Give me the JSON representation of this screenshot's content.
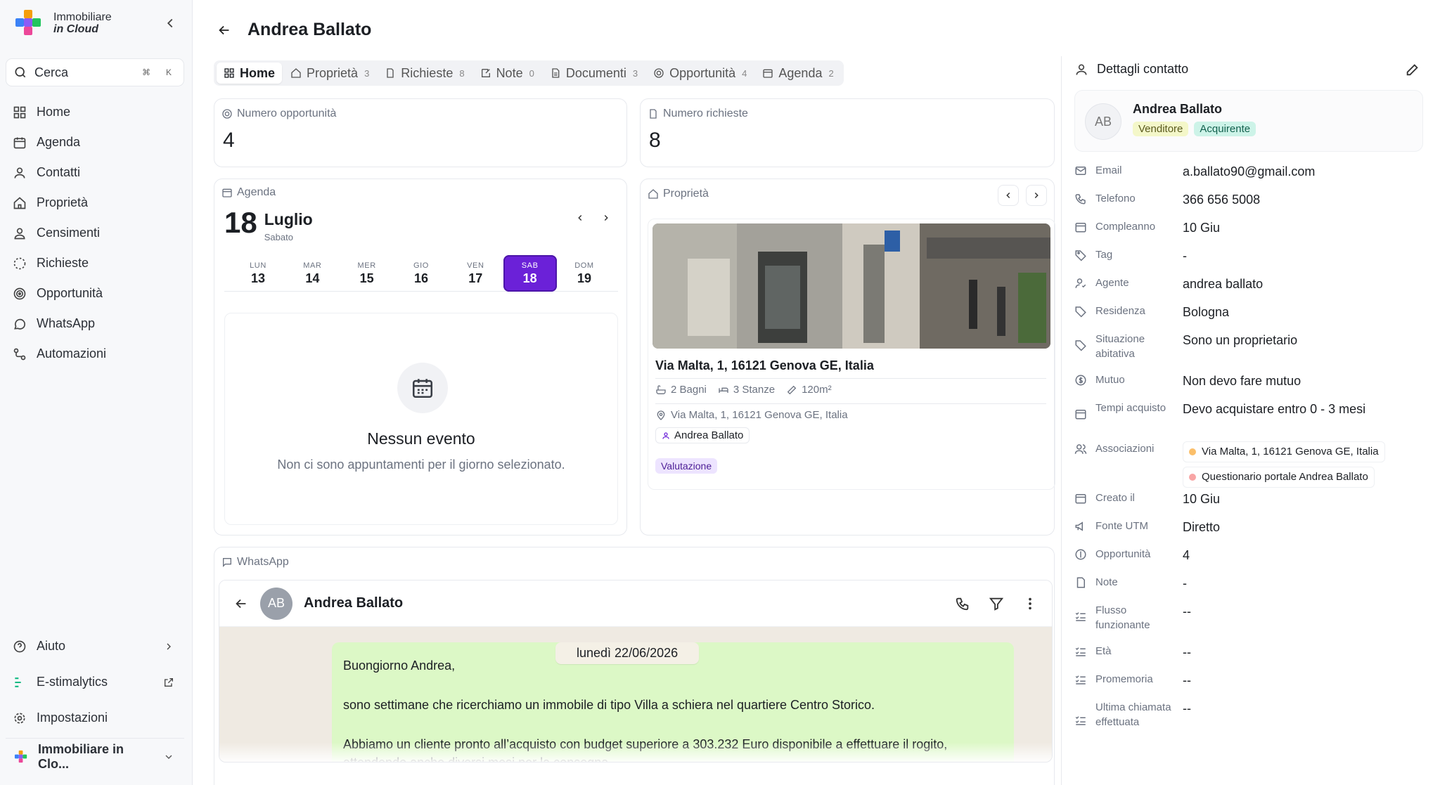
{
  "brand": {
    "line1": "Immobiliare",
    "line2": "in Cloud"
  },
  "search": {
    "placeholder": "Cerca",
    "shortcut_mod": "⌘",
    "shortcut_key": "K"
  },
  "sidebar": {
    "items": [
      {
        "label": "Home",
        "icon": "grid-icon"
      },
      {
        "label": "Agenda",
        "icon": "calendar-icon"
      },
      {
        "label": "Contatti",
        "icon": "user-icon"
      },
      {
        "label": "Proprietà",
        "icon": "home-icon"
      },
      {
        "label": "Censimenti",
        "icon": "user-check-icon"
      },
      {
        "label": "Richieste",
        "icon": "dashed-circle-icon"
      },
      {
        "label": "Opportunità",
        "icon": "target-icon"
      },
      {
        "label": "WhatsApp",
        "icon": "whatsapp-icon"
      },
      {
        "label": "Automazioni",
        "icon": "workflow-icon"
      }
    ],
    "bottom": {
      "help": "Aiuto",
      "estimalytics": "E-stimalytics",
      "settings": "Impostazioni"
    },
    "org_name": "Immobiliare in Clo..."
  },
  "header": {
    "title": "Andrea Ballato"
  },
  "tabs": [
    {
      "label": "Home",
      "count": ""
    },
    {
      "label": "Proprietà",
      "count": "3"
    },
    {
      "label": "Richieste",
      "count": "8"
    },
    {
      "label": "Note",
      "count": "0"
    },
    {
      "label": "Documenti",
      "count": "3"
    },
    {
      "label": "Opportunità",
      "count": "4"
    },
    {
      "label": "Agenda",
      "count": "2"
    }
  ],
  "stats": {
    "opportunities_label": "Numero opportunità",
    "opportunities_value": "4",
    "requests_label": "Numero richieste",
    "requests_value": "8"
  },
  "agenda": {
    "label": "Agenda",
    "day": "18",
    "month": "Luglio",
    "weekday": "Sabato",
    "week": [
      {
        "dn": "LUN",
        "num": "13"
      },
      {
        "dn": "MAR",
        "num": "14"
      },
      {
        "dn": "MER",
        "num": "15"
      },
      {
        "dn": "GIO",
        "num": "16"
      },
      {
        "dn": "VEN",
        "num": "17"
      },
      {
        "dn": "SAB",
        "num": "18"
      },
      {
        "dn": "DOM",
        "num": "19"
      }
    ],
    "empty_title": "Nessun evento",
    "empty_sub": "Non ci sono appuntamenti per il giorno selezionato."
  },
  "property": {
    "label": "Proprietà",
    "address": "Via Malta, 1, 16121 Genova GE, Italia",
    "bathrooms": "2 Bagni",
    "rooms": "3 Stanze",
    "area": "120m²",
    "location": "Via Malta, 1, 16121 Genova GE, Italia",
    "owner": "Andrea Ballato",
    "badge": "Valutazione"
  },
  "whatsapp": {
    "label": "WhatsApp",
    "avatar": "AB",
    "contact": "Andrea Ballato",
    "date_chip": "lunedì 22/06/2026",
    "messages": [
      "Buongiorno Andrea,",
      "sono settimane che ricerchiamo un immobile di tipo Villa a schiera nel quartiere Centro Storico.",
      "Abbiamo un cliente pronto all’acquisto con budget superiore a 303.232 Euro disponibile a effettuare il rogito,",
      "attendendo anche diversi mesi per la consegna."
    ]
  },
  "contact": {
    "panel_title": "Dettagli contatto",
    "initials": "AB",
    "name": "Andrea Ballato",
    "tags": [
      "Venditore",
      "Acquirente"
    ],
    "fields": {
      "email": {
        "label": "Email",
        "value": "a.ballato90@gmail.com"
      },
      "phone": {
        "label": "Telefono",
        "value": "366 656 5008"
      },
      "birthday": {
        "label": "Compleanno",
        "value": "10 Giu"
      },
      "tag": {
        "label": "Tag",
        "value": "-"
      },
      "agent": {
        "label": "Agente",
        "value": "andrea ballato"
      },
      "residence": {
        "label": "Residenza",
        "value": "Bologna"
      },
      "housing": {
        "label": "Situazione abitativa",
        "value": "Sono un proprietario"
      },
      "mortgage": {
        "label": "Mutuo",
        "value": "Non devo fare mutuo"
      },
      "timing": {
        "label": "Tempi acquisto",
        "value": "Devo acquistare entro 0 - 3 mesi"
      },
      "associations": {
        "label": "Associazioni",
        "items": [
          "Via Malta, 1, 16121 Genova GE, Italia",
          "Questionario portale Andrea Ballato"
        ]
      },
      "created": {
        "label": "Creato il",
        "value": "10 Giu"
      },
      "utm": {
        "label": "Fonte UTM",
        "value": "Diretto"
      },
      "opportunities": {
        "label": "Opportunità",
        "value": "4"
      },
      "notes": {
        "label": "Note",
        "value": "-"
      },
      "workflow": {
        "label": "Flusso funzionante",
        "value": "--"
      },
      "age": {
        "label": "Età",
        "value": "--"
      },
      "reminder": {
        "label": "Promemoria",
        "value": "--"
      },
      "last_call": {
        "label": "Ultima chiamata effettuata",
        "value": "--"
      }
    }
  },
  "colors": {
    "accent": "#6b21d8",
    "tag_seller": "#f4f7c9",
    "tag_buyer": "#cdf3e8",
    "chat_bubble": "#dcf8c6"
  }
}
